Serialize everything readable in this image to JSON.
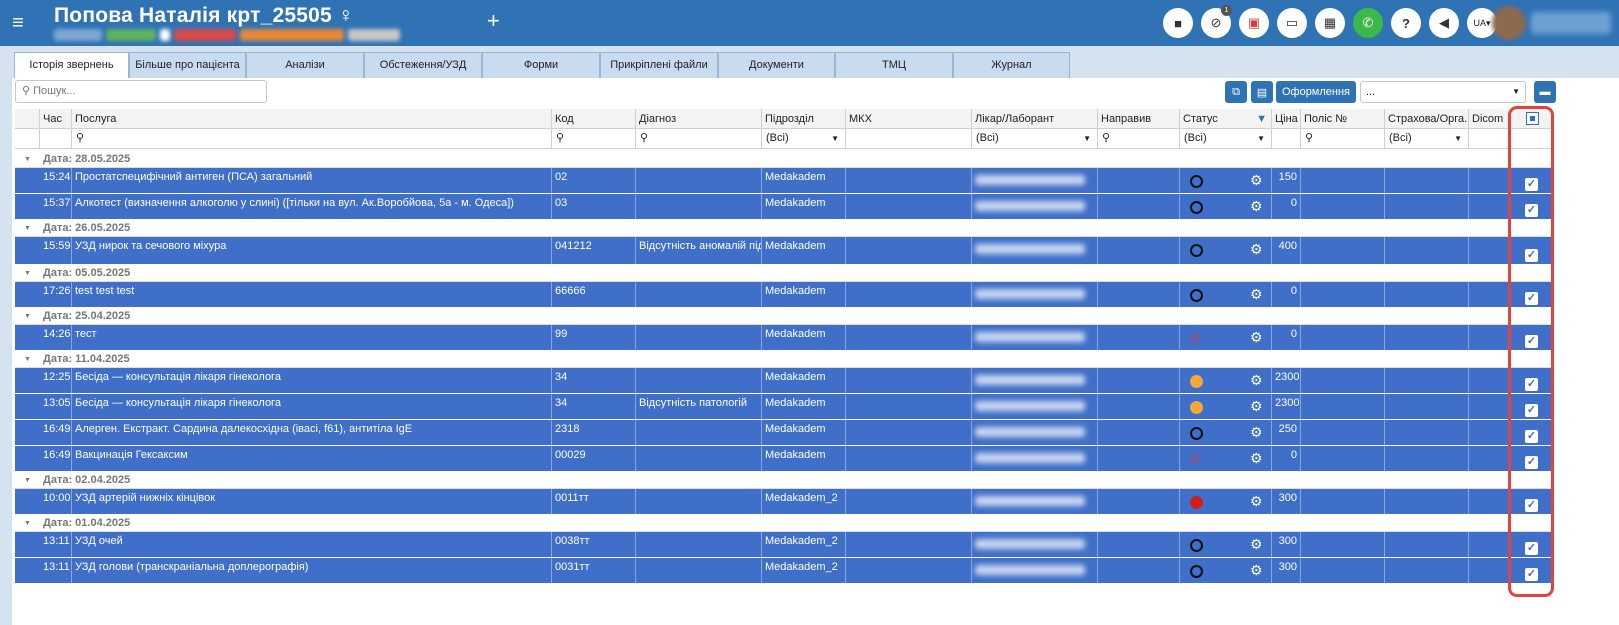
{
  "patient": {
    "name": "Попова Наталія крт_25505 ♀"
  },
  "topbar": {
    "menu_icon": "hamburger-icon",
    "add_icon": "plus-icon",
    "lang": "UA▾"
  },
  "tabs": [
    {
      "label": "Історія звернень"
    },
    {
      "label": "Більше про пацієнта"
    },
    {
      "label": "Аналізи"
    },
    {
      "label": "Обстеження/УЗД"
    },
    {
      "label": "Форми"
    },
    {
      "label": "Прикріплені файли"
    },
    {
      "label": "Документи"
    },
    {
      "label": "ТМЦ"
    },
    {
      "label": "Журнал"
    }
  ],
  "search": {
    "placeholder": "Пошук..."
  },
  "toolbar": {
    "oform_label": "Оформлення",
    "select_value": "..."
  },
  "columns": {
    "time": "Час",
    "service": "Послуга",
    "code": "Код",
    "diag": "Діагноз",
    "dept": "Підрозділ",
    "mkh": "МКХ",
    "doctor": "Лікар/Лаборант",
    "referrer": "Направив",
    "status": "Статус",
    "price": "Ціна",
    "policy": "Поліс №",
    "insurance": "Страхова/Орга...",
    "dicom": "Dicom"
  },
  "filters": {
    "all": "(Всі)"
  },
  "groups": [
    {
      "label": "Дата: 28.05.2025",
      "rows": [
        {
          "time": "15:24",
          "service": "Простатспецифічний антиген (ПСА) загальний",
          "code": "02",
          "diag": "",
          "dept": "Medakadem",
          "status": "open",
          "price": "150"
        },
        {
          "time": "15:37",
          "service": "Алкотест (визначення алкоголю у слині) ([тільки на вул. Ак.Воробйова, 5а - м. Одеса])",
          "code": "03",
          "diag": "",
          "dept": "Medakadem",
          "status": "open",
          "price": "0"
        }
      ]
    },
    {
      "label": "Дата: 26.05.2025",
      "rows": [
        {
          "time": "15:59",
          "service": "УЗД нирок та сечового міхура",
          "code": "041212",
          "diag": "Відсутність аномалій під...",
          "dept": "Medakadem",
          "status": "open",
          "price": "400"
        }
      ]
    },
    {
      "label": "Дата: 05.05.2025",
      "rows": [
        {
          "time": "17:26",
          "service": "test test test",
          "code": "66666",
          "diag": "",
          "dept": "Medakadem",
          "status": "open",
          "price": "0"
        }
      ]
    },
    {
      "label": "Дата: 25.04.2025",
      "rows": [
        {
          "time": "14:26",
          "service": "тест",
          "code": "99",
          "diag": "",
          "dept": "Medakadem",
          "status": "pdf",
          "price": "0"
        }
      ]
    },
    {
      "label": "Дата: 11.04.2025",
      "rows": [
        {
          "time": "12:25",
          "service": "Бесіда — консультація  лікаря гінеколога",
          "code": "34",
          "diag": "",
          "dept": "Medakadem",
          "status": "yellow",
          "price": "2300"
        },
        {
          "time": "13:05",
          "service": "Бесіда — консультація  лікаря гінеколога",
          "code": "34",
          "diag": "Відсутність патологій",
          "dept": "Medakadem",
          "status": "yellow",
          "price": "2300"
        },
        {
          "time": "16:49",
          "service": "Алерген. Екстракт. Сардина далекосхідна (івасі, f61), антитіла IgE",
          "code": "2318",
          "diag": "",
          "dept": "Medakadem",
          "status": "open",
          "price": "250"
        },
        {
          "time": "16:49",
          "service": "Вакцинація Гексаксим",
          "code": "00029",
          "diag": "",
          "dept": "Medakadem",
          "status": "pdf",
          "price": "0"
        }
      ]
    },
    {
      "label": "Дата: 02.04.2025",
      "rows": [
        {
          "time": "10:00",
          "service": "УЗД артерій нижніх кінцівок",
          "code": "0011тт",
          "diag": "",
          "dept": "Medakadem_2",
          "status": "red",
          "price": "300"
        }
      ]
    },
    {
      "label": "Дата: 01.04.2025",
      "rows": [
        {
          "time": "13:11",
          "service": "УЗД очей",
          "code": "0038тт",
          "diag": "",
          "dept": "Medakadem_2",
          "status": "open",
          "price": "300"
        },
        {
          "time": "13:11",
          "service": "УЗД голови (транскраніальна доплерографія)",
          "code": "0031тт",
          "diag": "",
          "dept": "Medakadem_2",
          "status": "open",
          "price": "300"
        }
      ]
    }
  ]
}
